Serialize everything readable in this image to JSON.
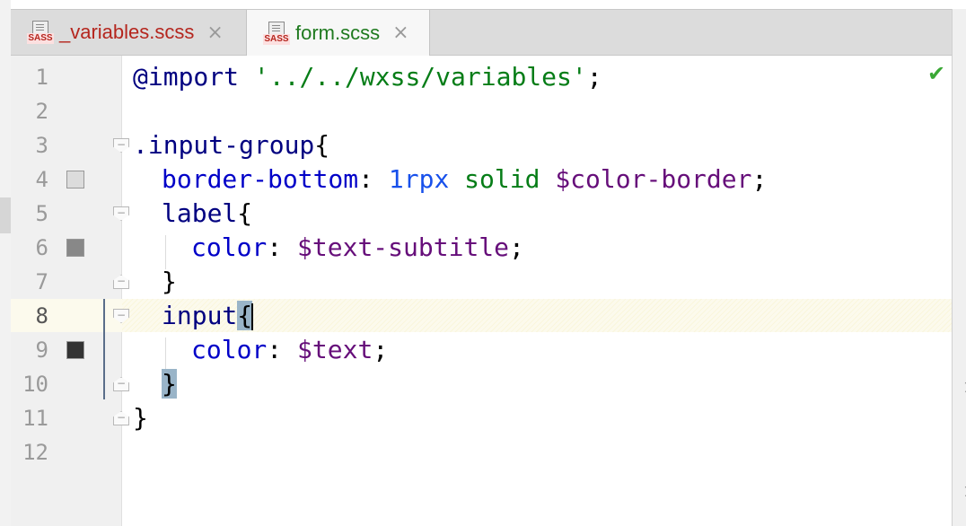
{
  "tabs": [
    {
      "icon": "sass-file-icon",
      "badge": "SASS",
      "name": "_variables.scss",
      "close": "×"
    },
    {
      "icon": "sass-file-icon",
      "badge": "SASS",
      "name": "form.scss",
      "close": "×"
    }
  ],
  "status": {
    "check_icon": "check-icon",
    "check": "✔"
  },
  "lines": [
    {
      "n": "1",
      "code": "@import '../../wxss/variables';"
    },
    {
      "n": "2",
      "code": ""
    },
    {
      "n": "3",
      "code": ".input-group{"
    },
    {
      "n": "4",
      "code": "  border-bottom: 1rpx solid $color-border;"
    },
    {
      "n": "5",
      "code": "  label{"
    },
    {
      "n": "6",
      "code": "    color: $text-subtitle;"
    },
    {
      "n": "7",
      "code": "  }"
    },
    {
      "n": "8",
      "code": "  input{"
    },
    {
      "n": "9",
      "code": "    color: $text;"
    },
    {
      "n": "10",
      "code": "  }"
    },
    {
      "n": "11",
      "code": "}"
    },
    {
      "n": "12",
      "code": ""
    }
  ],
  "tokens": {
    "l1": {
      "at": "@import",
      "str": "'../../wxss/variables'",
      "semi": ";"
    },
    "l3": {
      "sel": ".input-group",
      "brace": "{"
    },
    "l4": {
      "prop": "border-bottom",
      "colon": ": ",
      "num": "1rpx",
      "sp": " ",
      "val": "solid",
      "sp2": " ",
      "var": "$color-border",
      "semi": ";"
    },
    "l5": {
      "tag": "label",
      "brace": "{"
    },
    "l6": {
      "prop": "color",
      "colon": ": ",
      "var": "$text-subtitle",
      "semi": ";"
    },
    "l7": {
      "brace": "}"
    },
    "l8": {
      "tag": "input",
      "brace": "{"
    },
    "l9": {
      "prop": "color",
      "colon": ": ",
      "var": "$text",
      "semi": ";"
    },
    "l10": {
      "brace": "}"
    },
    "l11": {
      "brace": "}"
    }
  },
  "swatches": {
    "color_border": "#dcdcdc",
    "text_subtitle": "#888888",
    "text": "#333333"
  },
  "colors": {
    "keyword": "#000080",
    "string": "#067d17",
    "property": "#0000c8",
    "variable": "#660e7a",
    "current_line": "#fcfaed"
  },
  "right_edge": [
    "1",
    "1"
  ]
}
